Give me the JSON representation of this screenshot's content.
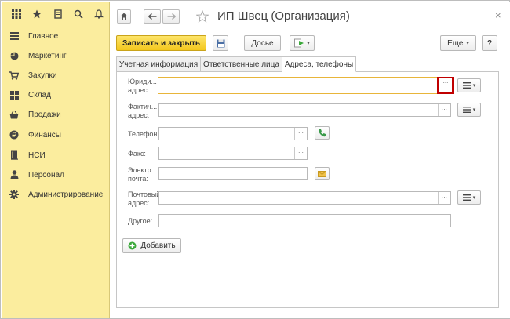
{
  "sidebar": {
    "items": [
      {
        "label": "Главное",
        "icon": "hamburger-icon"
      },
      {
        "label": "Маркетинг",
        "icon": "pie-icon"
      },
      {
        "label": "Закупки",
        "icon": "cart-icon"
      },
      {
        "label": "Склад",
        "icon": "grid-icon"
      },
      {
        "label": "Продажи",
        "icon": "basket-icon"
      },
      {
        "label": "Финансы",
        "icon": "coin-icon"
      },
      {
        "label": "НСИ",
        "icon": "book-icon"
      },
      {
        "label": "Персонал",
        "icon": "person-icon"
      },
      {
        "label": "Администрирование",
        "icon": "gear-icon"
      }
    ]
  },
  "header": {
    "title": "ИП Швец (Организация)",
    "close": "×"
  },
  "toolbar": {
    "save_close": "Записать и закрыть",
    "dossier": "Досье",
    "more": "Еще",
    "help": "?"
  },
  "tabs": [
    {
      "label": "Учетная информация",
      "active": false
    },
    {
      "label": "Ответственные лица",
      "active": false
    },
    {
      "label": "Адреса, телефоны",
      "active": true
    }
  ],
  "form": {
    "legal_address_label": "Юриди...\nадрес:",
    "actual_address_label": "Фактич...\nадрес:",
    "phone_label": "Телефон:",
    "fax_label": "Факс:",
    "email_label": "Электр...\nпочта:",
    "postal_address_label": "Почтовый\nадрес:",
    "other_label": "Другое:",
    "select_glyph": "...",
    "add_label": "Добавить"
  },
  "colors": {
    "sidebar_bg": "#fbed9e",
    "accent_button": "#f3c71d",
    "focus_border": "#e8b53a",
    "highlight": "#c00000"
  }
}
